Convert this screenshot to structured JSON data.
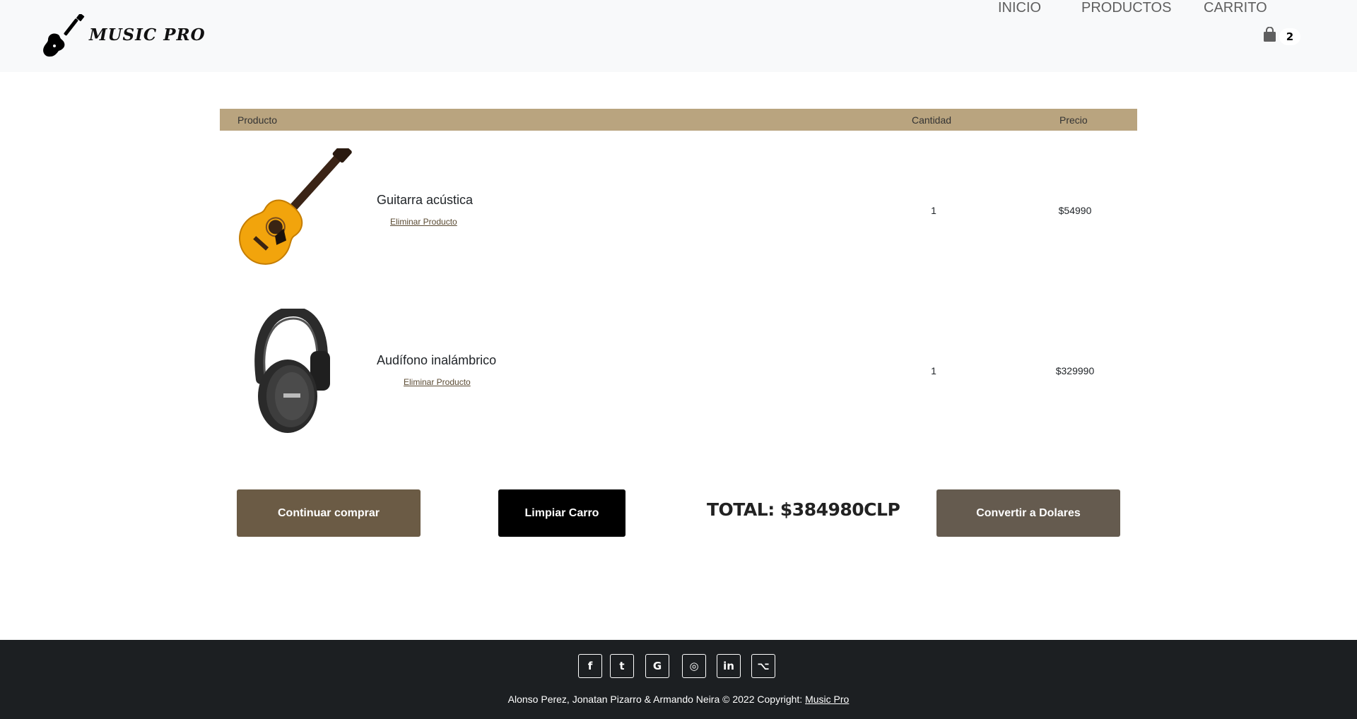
{
  "brand": {
    "name": "MUSIC PRO",
    "logo_icon": "guitar-icon"
  },
  "nav": {
    "items": [
      {
        "label": "INICIO"
      },
      {
        "label": "PRODUCTOS"
      },
      {
        "label": "CARRITO"
      }
    ],
    "cart_icon": "shopping-bag-icon",
    "cart_count": "2"
  },
  "cart": {
    "headers": {
      "product": "Producto",
      "quantity": "Cantidad",
      "price": "Precio"
    },
    "items": [
      {
        "name": "Guitarra acústica",
        "remove_label": "Eliminar Producto",
        "quantity": "1",
        "price": "$54990",
        "image": "acoustic-guitar-image"
      },
      {
        "name": "Audífono inalámbrico",
        "remove_label": "Eliminar Producto",
        "quantity": "1",
        "price": "$329990",
        "image": "headphones-image"
      }
    ],
    "continue_label": "Continuar comprar",
    "clear_label": "Limpiar Carro",
    "total_label": "TOTAL: $384980CLP",
    "convert_label": "Convertir a Dolares"
  },
  "footer": {
    "social": [
      {
        "glyph": "f",
        "icon": "facebook-icon"
      },
      {
        "glyph": "t",
        "icon": "twitter-icon"
      },
      {
        "glyph": "G",
        "icon": "google-icon"
      },
      {
        "glyph": "◎",
        "icon": "instagram-icon"
      },
      {
        "glyph": "in",
        "icon": "linkedin-icon"
      },
      {
        "glyph": "⌥",
        "icon": "github-icon"
      }
    ],
    "copyright_text": "Alonso Perez, Jonatan Pizarro & Armando Neira © 2022 Copyright: ",
    "copyright_link": "Music Pro"
  },
  "colors": {
    "table_header": "#b9a47f",
    "continue_button": "#6b5b45",
    "clear_button": "#000000",
    "convert_button": "#655b4f",
    "footer_bg": "#1c1f22",
    "navbar_bg": "#f8f9fa"
  }
}
